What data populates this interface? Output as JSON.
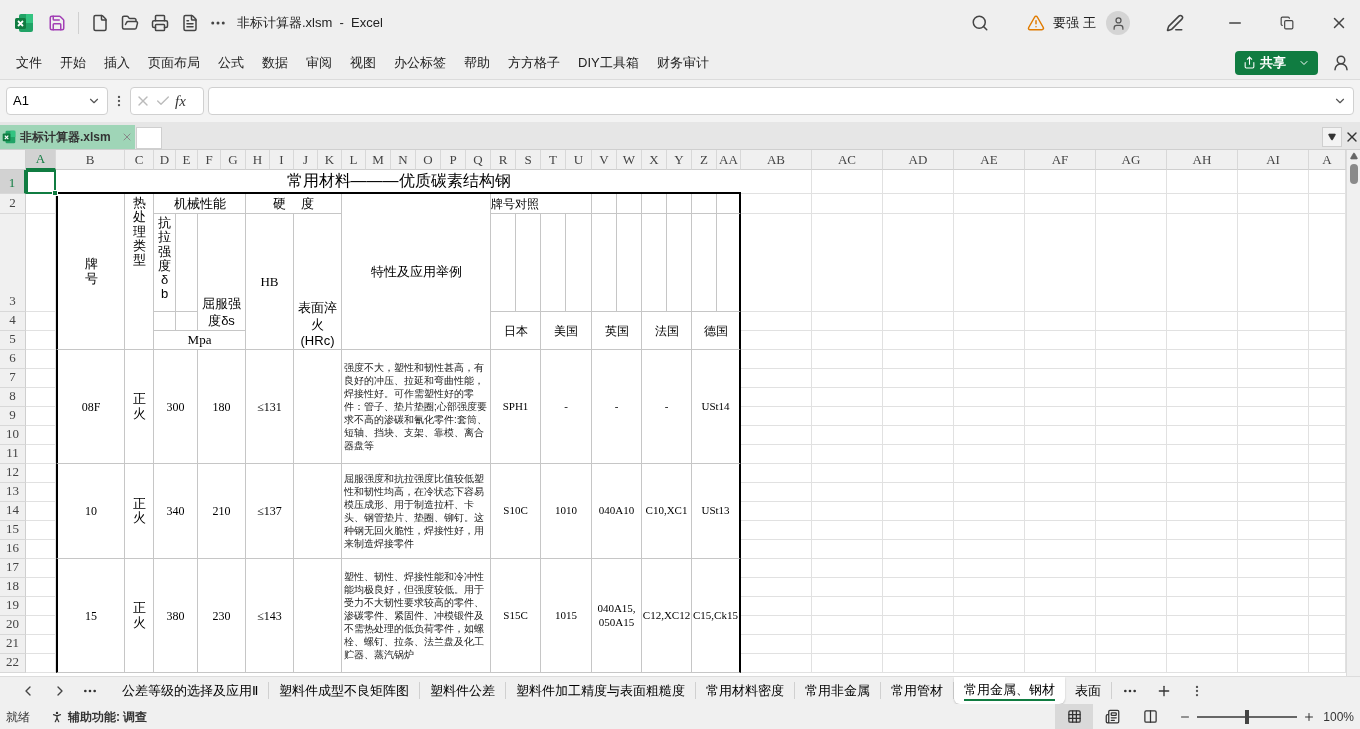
{
  "window": {
    "title": "非标计算器.xlsm  -  Excel",
    "user": "要强 王"
  },
  "menu": [
    "文件",
    "开始",
    "插入",
    "页面布局",
    "公式",
    "数据",
    "审阅",
    "视图",
    "办公标签",
    "帮助",
    "方方格子",
    "DIY工具箱",
    "财务审计"
  ],
  "share_button": "共享",
  "formula_bar": {
    "name_box": "A1",
    "function_label": "fx"
  },
  "workbook_tabs": [
    {
      "label": "非标计算器.xlsm",
      "selected": true
    }
  ],
  "column_headers": [
    {
      "label": "A",
      "selected": true
    },
    {
      "label": "B",
      "selected": false
    },
    {
      "label": "C",
      "selected": false
    },
    {
      "label": "D",
      "selected": false
    },
    {
      "label": "E",
      "selected": false
    },
    {
      "label": "F",
      "selected": false
    },
    {
      "label": "G",
      "selected": false
    },
    {
      "label": "H",
      "selected": false
    },
    {
      "label": "I",
      "selected": false
    },
    {
      "label": "J",
      "selected": false
    },
    {
      "label": "K",
      "selected": false
    },
    {
      "label": "L",
      "selected": false
    },
    {
      "label": "M",
      "selected": false
    },
    {
      "label": "N",
      "selected": false
    },
    {
      "label": "O",
      "selected": false
    },
    {
      "label": "P",
      "selected": false
    },
    {
      "label": "Q",
      "selected": false
    },
    {
      "label": "R",
      "selected": false
    },
    {
      "label": "S",
      "selected": false
    },
    {
      "label": "T",
      "selected": false
    },
    {
      "label": "U",
      "selected": false
    },
    {
      "label": "V",
      "selected": false
    },
    {
      "label": "W",
      "selected": false
    },
    {
      "label": "X",
      "selected": false
    },
    {
      "label": "Y",
      "selected": false
    },
    {
      "label": "Z",
      "selected": false
    },
    {
      "label": "AA",
      "selected": false
    },
    {
      "label": "AB",
      "selected": false
    },
    {
      "label": "AC",
      "selected": false
    },
    {
      "label": "AD",
      "selected": false
    },
    {
      "label": "AE",
      "selected": false
    },
    {
      "label": "AF",
      "selected": false
    },
    {
      "label": "AG",
      "selected": false
    },
    {
      "label": "AH",
      "selected": false
    },
    {
      "label": "AI",
      "selected": false
    },
    {
      "label": "A",
      "selected": false
    }
  ],
  "row_headers": [
    {
      "label": "1",
      "selected": true
    },
    {
      "label": "2",
      "selected": false
    },
    {
      "label": "3",
      "selected": false
    },
    {
      "label": "4",
      "selected": false
    },
    {
      "label": "5",
      "selected": false
    },
    {
      "label": "6",
      "selected": false
    },
    {
      "label": "7",
      "selected": false
    },
    {
      "label": "8",
      "selected": false
    },
    {
      "label": "9",
      "selected": false
    },
    {
      "label": "10",
      "selected": false
    },
    {
      "label": "11",
      "selected": false
    },
    {
      "label": "12",
      "selected": false
    },
    {
      "label": "13",
      "selected": false
    },
    {
      "label": "14",
      "selected": false
    },
    {
      "label": "15",
      "selected": false
    },
    {
      "label": "16",
      "selected": false
    },
    {
      "label": "17",
      "selected": false
    },
    {
      "label": "18",
      "selected": false
    },
    {
      "label": "19",
      "selected": false
    },
    {
      "label": "20",
      "selected": false
    },
    {
      "label": "21",
      "selected": false
    },
    {
      "label": "22",
      "selected": false
    }
  ],
  "sheet": {
    "title": "常用材料———优质碳素结构钢",
    "headers": {
      "grade": "牌号",
      "heat_treatment": "热处理类型",
      "mechanical": "机械性能",
      "tensile": "抗拉强度δb",
      "yield": "屈服强度δs",
      "unit": "Mpa",
      "hardness": "硬    度",
      "hb": "HB",
      "surface": "表面淬火\n(HRc)",
      "application": "特性及应用举例",
      "equivalents": "牌号对照",
      "countries": [
        "日本",
        "美国",
        "英国",
        "法国",
        "德国"
      ]
    },
    "rows": [
      {
        "grade": "08F",
        "heat_treatment": "正火",
        "tensile": "300",
        "yield": "180",
        "hb": "≤131",
        "application": "强度不大，塑性和韧性甚高，有良好的冲压、拉延和弯曲性能，焊接性好。可作需塑性好的零件：管子、垫片垫圈;心部强度要求不高的渗碳和氰化零件:套筒、短轴、挡块、支架、靠模、离合器盘等",
        "equivalents": [
          "SPH1",
          "-",
          "-",
          "-",
          "USt14"
        ]
      },
      {
        "grade": "10",
        "heat_treatment": "正火",
        "tensile": "340",
        "yield": "210",
        "hb": "≤137",
        "application": "屈服强度和抗拉强度比值较低塑性和韧性均高，在冷状态下容易模压成形、用于制造拉杆、卡头、钢管垫片、垫圈、铆钉。这种钢无回火脆性，焊接性好，用来制造焊接零件",
        "equivalents": [
          "S10C",
          "1010",
          "040A10",
          "C10,XC1",
          "USt13"
        ]
      },
      {
        "grade": "15",
        "heat_treatment": "正火",
        "tensile": "380",
        "yield": "230",
        "hb": "≤143",
        "application": "塑性、韧性、焊接性能和冷冲性能均极良好，但强度较低。用于受力不大韧性要求较高的零件、渗碳零件、紧固件、冲模锻件及不需热处理的低负荷零件，如螺栓、螺钉、拉条、法兰盘及化工贮器、蒸汽锅炉",
        "equivalents": [
          "S15C",
          "1015",
          "040A15,\n050A15",
          "C12,XC12",
          "C15,Ck15"
        ]
      }
    ]
  },
  "sheet_tabs": [
    {
      "label": "公差等级的选择及应用Ⅱ",
      "selected": false
    },
    {
      "label": "塑料件成型不良矩阵图",
      "selected": false
    },
    {
      "label": "塑料件公差",
      "selected": false
    },
    {
      "label": "塑料件加工精度与表面粗糙度",
      "selected": false
    },
    {
      "label": "常用材料密度",
      "selected": false
    },
    {
      "label": "常用非金属",
      "selected": false
    },
    {
      "label": "常用管材",
      "selected": false
    },
    {
      "label": "常用金属、钢材",
      "selected": true
    },
    {
      "label": "表面",
      "selected": false
    }
  ],
  "status_bar": {
    "status": "就绪",
    "accessibility": "辅助功能: 调查",
    "views": [
      {
        "kind": "normal",
        "selected": true
      },
      {
        "kind": "page_layout",
        "selected": false
      },
      {
        "kind": "page_break",
        "selected": false
      }
    ],
    "zoom": {
      "level": 0.5,
      "label": "100%"
    }
  }
}
